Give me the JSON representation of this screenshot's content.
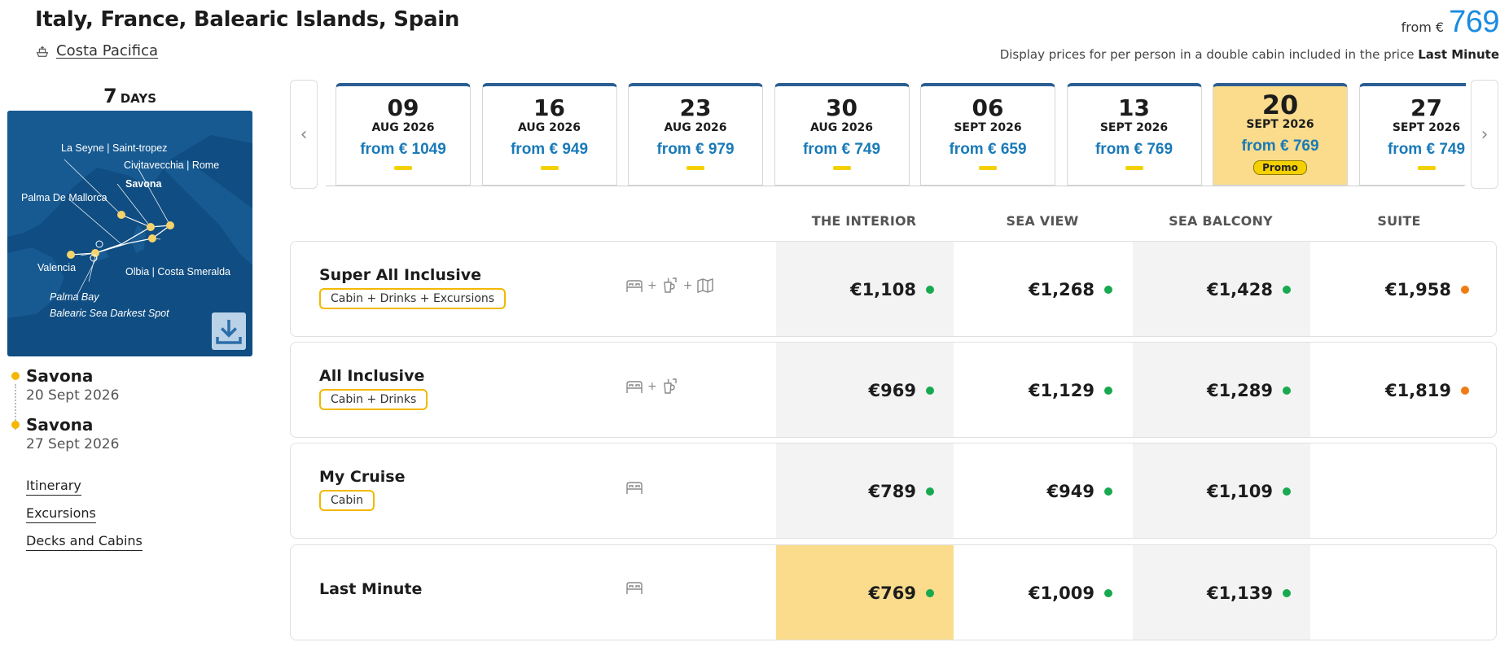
{
  "cruise": {
    "title": "Italy, France, Balearic Islands, Spain",
    "ship": "Costa Pacifica",
    "price_prefix": "from €",
    "price": "769",
    "price_note": "Display prices for per person in a double cabin included in the price",
    "price_note_bold": "Last Minute"
  },
  "duration": {
    "value": "7",
    "unit": "DAYS"
  },
  "map": {
    "labels": [
      "La Seyne | Saint-tropez",
      "Civitavecchia | Rome",
      "Savona",
      "Palma De Mallorca",
      "Valencia",
      "Olbia | Costa Smeralda",
      "Palma Bay",
      "Balearic Sea Darkest Spot"
    ],
    "download_icon": "download-icon"
  },
  "stops": [
    {
      "name": "Savona",
      "date": "20 Sept 2026"
    },
    {
      "name": "Savona",
      "date": "27 Sept 2026"
    }
  ],
  "links": [
    "Itinerary",
    "Excursions",
    "Decks and Cabins"
  ],
  "dates": [
    {
      "day": "09",
      "month": "AUG 2026",
      "price": "from € 1049",
      "selected": false
    },
    {
      "day": "16",
      "month": "AUG 2026",
      "price": "from € 949",
      "selected": false
    },
    {
      "day": "23",
      "month": "AUG 2026",
      "price": "from € 979",
      "selected": false
    },
    {
      "day": "30",
      "month": "AUG 2026",
      "price": "from € 749",
      "selected": false
    },
    {
      "day": "06",
      "month": "SEPT 2026",
      "price": "from € 659",
      "selected": false
    },
    {
      "day": "13",
      "month": "SEPT 2026",
      "price": "from € 769",
      "selected": false
    },
    {
      "day": "20",
      "month": "SEPT 2026",
      "price": "from € 769",
      "selected": true,
      "badge": "Promo"
    },
    {
      "day": "27",
      "month": "SEPT 2026",
      "price": "from € 749",
      "selected": false
    }
  ],
  "columns": [
    "THE INTERIOR",
    "SEA VIEW",
    "SEA BALCONY",
    "SUITE"
  ],
  "packages": [
    {
      "name": "Super All Inclusive",
      "tag": "Cabin + Drinks + Excursions",
      "icons": [
        "bed-icon",
        "drink-icon",
        "map-icon"
      ],
      "prices": [
        {
          "value": "€1,108",
          "status": "green"
        },
        {
          "value": "€1,268",
          "status": "green"
        },
        {
          "value": "€1,428",
          "status": "green"
        },
        {
          "value": "€1,958",
          "status": "orange"
        }
      ]
    },
    {
      "name": "All Inclusive",
      "tag": "Cabin + Drinks",
      "icons": [
        "bed-icon",
        "drink-icon"
      ],
      "prices": [
        {
          "value": "€969",
          "status": "green"
        },
        {
          "value": "€1,129",
          "status": "green"
        },
        {
          "value": "€1,289",
          "status": "green"
        },
        {
          "value": "€1,819",
          "status": "orange"
        }
      ]
    },
    {
      "name": "My Cruise",
      "tag": "Cabin",
      "icons": [
        "bed-icon"
      ],
      "prices": [
        {
          "value": "€789",
          "status": "green"
        },
        {
          "value": "€949",
          "status": "green"
        },
        {
          "value": "€1,109",
          "status": "green"
        },
        null
      ]
    },
    {
      "name": "Last Minute",
      "tag": "",
      "icons": [
        "bed-icon"
      ],
      "highlight": true,
      "prices": [
        {
          "value": "€769",
          "status": "green"
        },
        {
          "value": "€1,009",
          "status": "green"
        },
        {
          "value": "€1,139",
          "status": "green"
        },
        null
      ]
    }
  ],
  "colors": {
    "accent": "#1a8be0",
    "highlight": "#fadc8c",
    "tag_border": "#f2b800",
    "available": "#18a94f",
    "limited": "#f07b12"
  }
}
